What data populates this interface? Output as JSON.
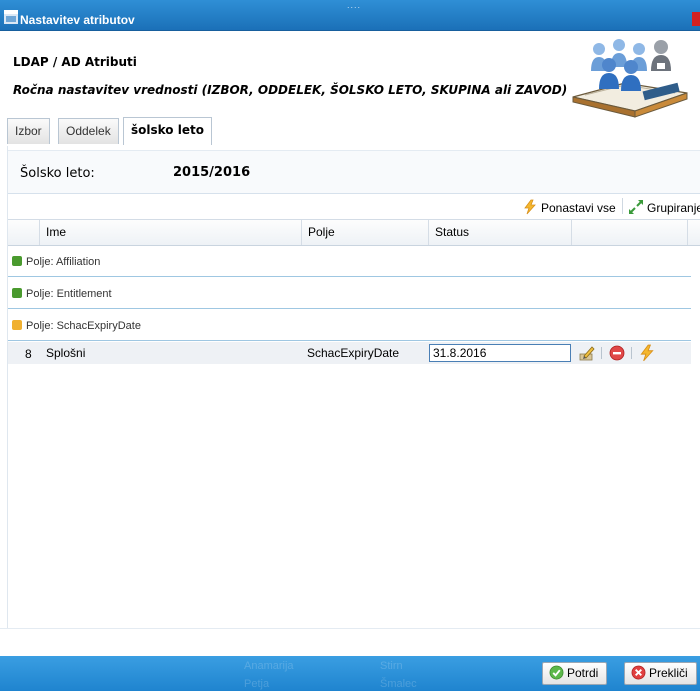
{
  "window": {
    "title": "Nastavitev atributov",
    "drag_handle": "....",
    "icons": {
      "window": "window-icon",
      "close": "close-icon"
    }
  },
  "header": {
    "title": "LDAP / AD Atributi",
    "subtitle": "Ročna nastavitev vrednosti (IZBOR, ODDELEK, ŠOLSKO LETO, SKUPINA ali ZAVOD)",
    "logo_icon": "users-book-icon"
  },
  "tabs": [
    {
      "label": "Izbor",
      "active": false
    },
    {
      "label": "Oddelek",
      "active": false
    },
    {
      "label": "šolsko leto",
      "active": true
    }
  ],
  "info": {
    "label": "Šolsko leto:",
    "value": "2015/2016"
  },
  "toolbar": {
    "reset_all": "Ponastavi vse",
    "grouping": "Grupiranje",
    "icons": {
      "reset": "lightning-icon",
      "grouping": "expand-arrows-icon"
    }
  },
  "grid": {
    "columns": [
      "Ime",
      "Polje",
      "Status"
    ],
    "groups": [
      {
        "label": "Polje: Affiliation",
        "expanded": false
      },
      {
        "label": "Polje: Entitlement",
        "expanded": false
      },
      {
        "label": "Polje: SchacExpiryDate",
        "expanded": true
      }
    ],
    "rows": [
      {
        "num": "8",
        "ime": "Splošni",
        "polje": "SchacExpiryDate",
        "status": "31.8.2016"
      }
    ],
    "row_action_icons": [
      "edit-icon",
      "delete-icon",
      "reset-icon"
    ]
  },
  "footer": {
    "confirm": "Potrdi",
    "cancel": "Prekliči",
    "ghost_text": [
      "Anamarija",
      "Stirn",
      "Petja",
      "Šmalec"
    ]
  },
  "colors": {
    "titlebar": "#1b70b8",
    "footer": "#2a90d8",
    "row_highlight": "#eef1f5",
    "group_line": "#9fc7e2"
  }
}
